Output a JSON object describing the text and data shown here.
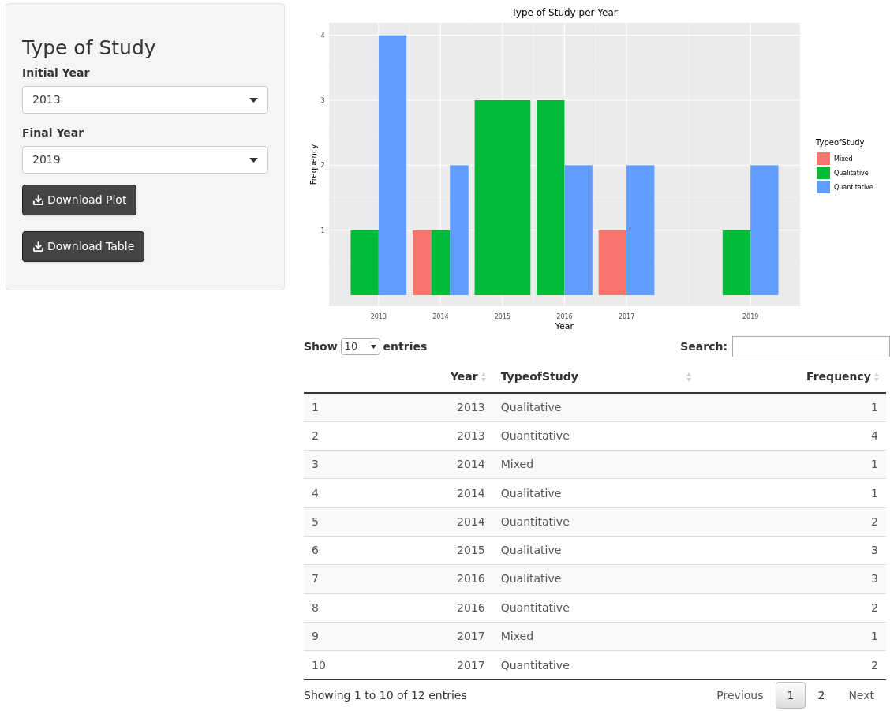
{
  "sidebar": {
    "title": "Type of Study",
    "fields": [
      {
        "label": "Initial Year",
        "value": "2013"
      },
      {
        "label": "Final Year",
        "value": "2019"
      }
    ],
    "buttons": [
      "Download Plot",
      "Download Table"
    ]
  },
  "plot": {
    "chart_data": {
      "type": "bar",
      "title": "Type of Study per Year",
      "xlabel": "Year",
      "ylabel": "Frequency",
      "x": [
        2013,
        2014,
        2015,
        2016,
        2017,
        2019
      ],
      "xlim": [
        2012.2,
        2019.8
      ],
      "ylim": [
        -0.17,
        4.19
      ],
      "xticks": [
        2013,
        2014,
        2015,
        2016,
        2017,
        2019
      ],
      "yticks": [
        1,
        2,
        3,
        4
      ],
      "legend_title": "TypeofStudy",
      "grid": true,
      "legend": "right",
      "series": [
        {
          "name": "Mixed",
          "color": "#f8766d",
          "values": [
            null,
            1,
            null,
            null,
            1,
            null
          ]
        },
        {
          "name": "Qualitative",
          "color": "#00ba38",
          "values": [
            1,
            1,
            3,
            3,
            null,
            1
          ]
        },
        {
          "name": "Quantitative",
          "color": "#619cff",
          "values": [
            4,
            2,
            null,
            2,
            2,
            2
          ]
        }
      ]
    }
  },
  "table": {
    "length_label_before": "Show",
    "length_value": "10",
    "length_label_after": "entries",
    "search_label": "Search:",
    "columns": [
      {
        "label": "Year",
        "sortable": true
      },
      {
        "label": "TypeofStudy",
        "sortable": true
      },
      {
        "label": "Frequency",
        "sortable": true
      }
    ],
    "rows": [
      {
        "number": "1",
        "cells": [
          "2013",
          "Qualitative",
          "1"
        ]
      },
      {
        "number": "2",
        "cells": [
          "2013",
          "Quantitative",
          "4"
        ]
      },
      {
        "number": "3",
        "cells": [
          "2014",
          "Mixed",
          "1"
        ]
      },
      {
        "number": "4",
        "cells": [
          "2014",
          "Qualitative",
          "1"
        ]
      },
      {
        "number": "5",
        "cells": [
          "2014",
          "Quantitative",
          "2"
        ]
      },
      {
        "number": "6",
        "cells": [
          "2015",
          "Qualitative",
          "3"
        ]
      },
      {
        "number": "7",
        "cells": [
          "2016",
          "Qualitative",
          "3"
        ]
      },
      {
        "number": "8",
        "cells": [
          "2016",
          "Quantitative",
          "2"
        ]
      },
      {
        "number": "9",
        "cells": [
          "2017",
          "Mixed",
          "1"
        ]
      },
      {
        "number": "10",
        "cells": [
          "2017",
          "Quantitative",
          "2"
        ]
      }
    ],
    "info": "Showing 1 to 10 of 12 entries",
    "pagination": [
      {
        "label": "Previous",
        "kind": "nav",
        "selected": false
      },
      {
        "label": "1",
        "kind": "page",
        "selected": true
      },
      {
        "label": "2",
        "kind": "page",
        "selected": false
      },
      {
        "label": "Next",
        "kind": "nav",
        "selected": false
      }
    ]
  }
}
